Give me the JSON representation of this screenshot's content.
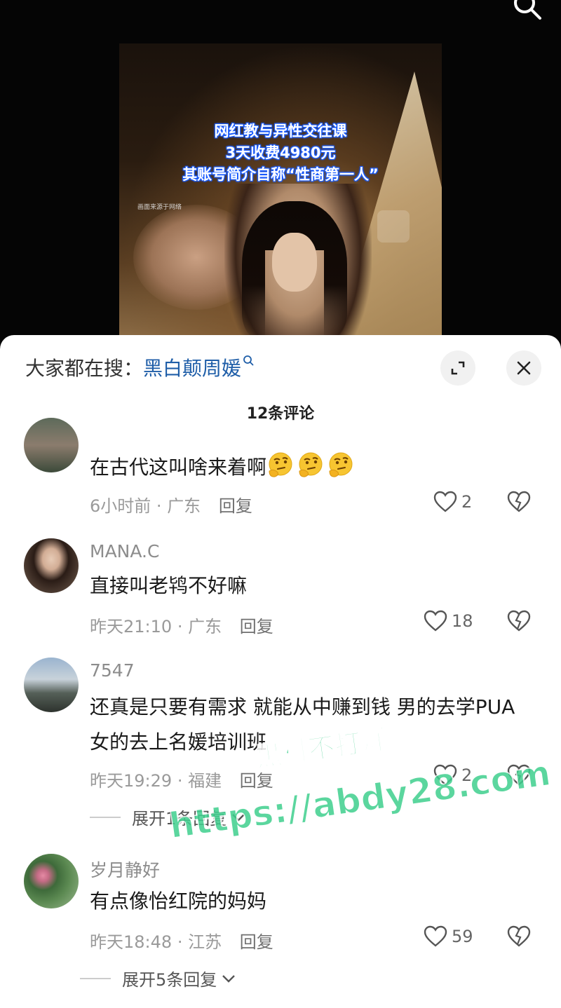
{
  "video": {
    "caption_lines": [
      "网红教与异性交往课",
      "3天收费4980元",
      "其账号简介自称“性商第一人”"
    ],
    "source_note": "画面来源于网络"
  },
  "sheet": {
    "hot_search_label": "大家都在搜：",
    "hot_search_keyword": "黑白颠周媛",
    "comment_count_title": "12条评论"
  },
  "comments": [
    {
      "username": "",
      "text": "在古代这叫啥来着啊",
      "emoji_count": 3,
      "time": "6小时前",
      "location": "广东",
      "reply_label": "回复",
      "likes": "2"
    },
    {
      "username": "MANA.C",
      "text": "直接叫老鸨不好嘛",
      "time": "昨天21:10",
      "location": "广东",
      "reply_label": "回复",
      "likes": "18"
    },
    {
      "username": "7547",
      "text": "还真是只要有需求 就能从中赚到钱  男的去学PUA  女的去上名媛培训班",
      "time": "昨天19:29",
      "location": "福建",
      "reply_label": "回复",
      "likes": "2",
      "expand_label": "展开1条回复"
    },
    {
      "username": "岁月静好",
      "text": "有点像怡红院的妈妈",
      "time": "昨天18:48",
      "location": "江苏",
      "reply_label": "回复",
      "likes": "59",
      "expand_label": "展开5条回复"
    }
  ],
  "watermark": {
    "line1": "黑料不打烊",
    "line2": "https://abdy28.com"
  },
  "colors": {
    "keyword_blue": "#1f5ea8",
    "caption_outline": "#1a5cff",
    "watermark_green": "#3fcf8e"
  },
  "icons": {
    "top_right": "search-icon",
    "expand": "fullscreen-icon",
    "close": "close-icon",
    "like": "heart-icon",
    "dislike": "broken-heart-icon"
  }
}
